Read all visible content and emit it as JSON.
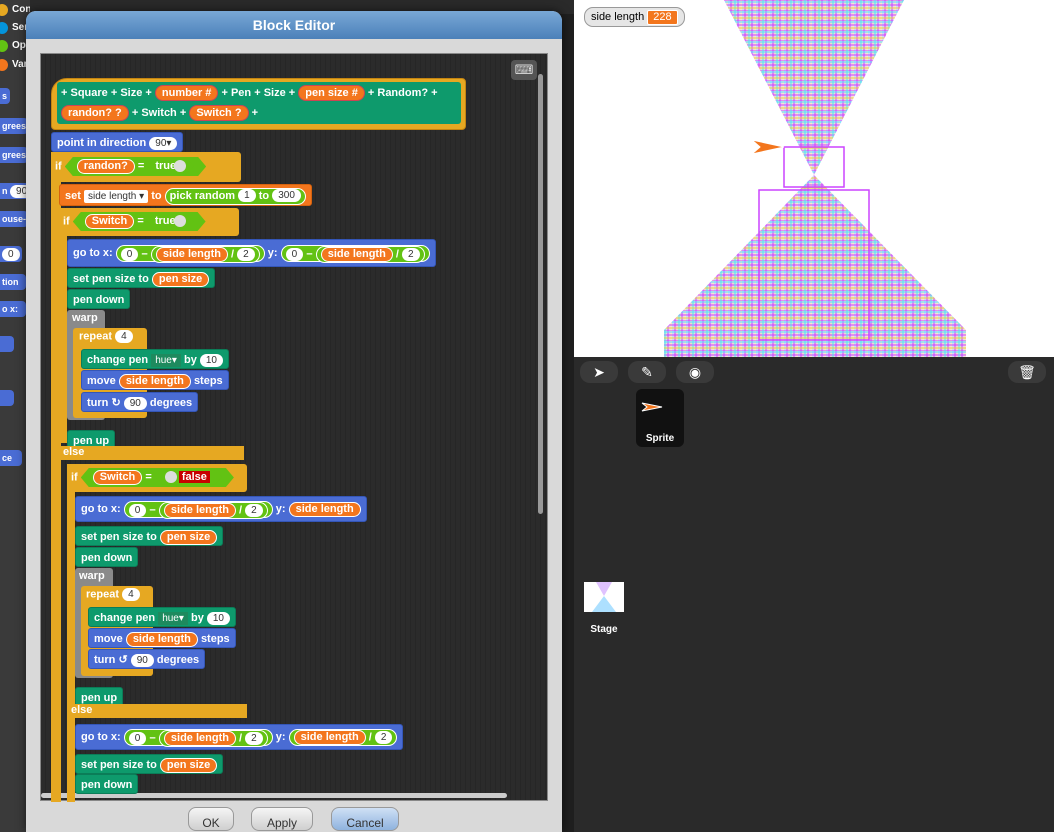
{
  "palette": {
    "categories": [
      {
        "label": "Control",
        "color": "#e6a822"
      },
      {
        "label": "Sensing",
        "color": "#0494dc"
      },
      {
        "label": "Operators",
        "color": "#62c213"
      },
      {
        "label": "Variables",
        "color": "#f3761d"
      }
    ],
    "fragments": [
      "s",
      "grees",
      "grees",
      "n",
      "90",
      "ouse-",
      "0",
      "tion",
      "o x:",
      "ce"
    ]
  },
  "dialog": {
    "title": "Block Editor",
    "buttons": {
      "ok": "OK",
      "apply": "Apply",
      "cancel": "Cancel"
    },
    "keyboard_icon": "keyboard-icon"
  },
  "script": {
    "hat": {
      "name_parts": [
        "Square",
        "Size"
      ],
      "inputs": [
        "number #",
        "pen size #",
        "randon? ?",
        "Switch ?"
      ],
      "labels": [
        "Pen",
        "Size",
        "Random?",
        "Switch"
      ]
    },
    "point_dir": {
      "label": "point in direction",
      "value": "90"
    },
    "if1": {
      "kw": "if",
      "var": "randon?",
      "eq": "=",
      "bool": "true"
    },
    "set": {
      "kw": "set",
      "var": "side length",
      "to": "to",
      "pick": "pick random",
      "a": "1",
      "to2": "to",
      "b": "300"
    },
    "if2": {
      "kw": "if",
      "var": "Switch",
      "eq": "=",
      "bool": "true"
    },
    "goto1": {
      "label": "go to x:",
      "zero": "0",
      "minus": "−",
      "var": "side length",
      "div": "/",
      "two": "2",
      "y": "y:"
    },
    "set_pen": {
      "label": "set pen size to",
      "var": "pen size"
    },
    "pen_down": "pen down",
    "warp": "warp",
    "repeat": {
      "label": "repeat",
      "n": "4"
    },
    "change_pen": {
      "label": "change pen",
      "prop": "hue",
      "by": "by",
      "val": "10"
    },
    "move": {
      "label": "move",
      "var": "side length",
      "steps": "steps"
    },
    "turn": {
      "label": "turn",
      "val": "90",
      "deg": "degrees"
    },
    "pen_up": "pen up",
    "else": "else",
    "if3": {
      "kw": "if",
      "var": "Switch",
      "eq": "=",
      "bool": "false"
    },
    "goto2": {
      "label": "go to x:",
      "zero": "0",
      "minus": "−",
      "var": "side length",
      "div": "/",
      "two": "2",
      "y": "y:",
      "yvar": "side length"
    },
    "goto3": {
      "label": "go to x:",
      "zero": "0",
      "minus": "−",
      "var": "side length",
      "div": "/",
      "two": "2",
      "y": "y:",
      "yvar": "side length"
    }
  },
  "stage": {
    "watcher": {
      "label": "side length",
      "value": "228"
    }
  },
  "corral": {
    "buttons": [
      "arrow-icon",
      "brush-icon",
      "camera-icon",
      "trash-icon"
    ],
    "sprite": "Sprite",
    "stage": "Stage"
  }
}
